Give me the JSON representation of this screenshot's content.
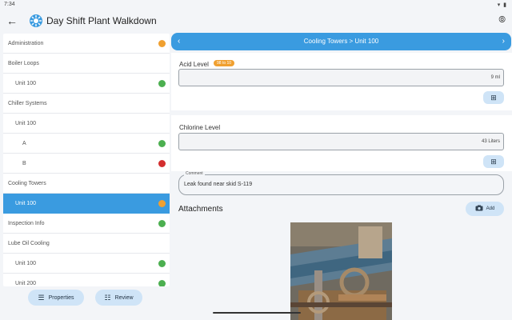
{
  "status": {
    "time": "7:34",
    "icons": "▾ ▮"
  },
  "appbar": {
    "title": "Day Shift Plant Walkdown",
    "back_glyph": "←",
    "right_glyph": "⦾"
  },
  "tree": {
    "items": [
      {
        "label": "Administration",
        "indent": 0,
        "dot": "orange"
      },
      {
        "label": "Boiler Loops",
        "indent": 0,
        "dot": ""
      },
      {
        "label": "Unit 100",
        "indent": 1,
        "dot": "green"
      },
      {
        "label": "Chiller Systems",
        "indent": 0,
        "dot": ""
      },
      {
        "label": "Unit 100",
        "indent": 1,
        "dot": ""
      },
      {
        "label": "A",
        "indent": 2,
        "dot": "green"
      },
      {
        "label": "B",
        "indent": 2,
        "dot": "red"
      },
      {
        "label": "Cooling Towers",
        "indent": 0,
        "dot": ""
      },
      {
        "label": "Unit 100",
        "indent": 1,
        "dot": "orange",
        "selected": true
      },
      {
        "label": "Inspection Info",
        "indent": 0,
        "dot": "green"
      },
      {
        "label": "Lube Oil Cooling",
        "indent": 0,
        "dot": ""
      },
      {
        "label": "Unit 100",
        "indent": 1,
        "dot": "green"
      },
      {
        "label": "Unit 200",
        "indent": 1,
        "dot": "green"
      }
    ],
    "dot_colors": {
      "orange": "#f0a030",
      "green": "#4caf50",
      "red": "#d32f2f"
    }
  },
  "buttons": {
    "properties": "Properties",
    "review": "Review"
  },
  "breadcrumb": {
    "text": "Cooling Towers > Unit 100",
    "prev": "‹",
    "next": "›"
  },
  "fields": {
    "acid": {
      "label": "Acid Level",
      "range_badge": "98 to 10",
      "value": "9 ml"
    },
    "chlorine": {
      "label": "Chlorine Level",
      "value": "43 Liters"
    }
  },
  "comment": {
    "legend": "Comment",
    "text": "Leak found near skid S-119"
  },
  "attachments": {
    "title": "Attachments",
    "add_label": "Add"
  }
}
